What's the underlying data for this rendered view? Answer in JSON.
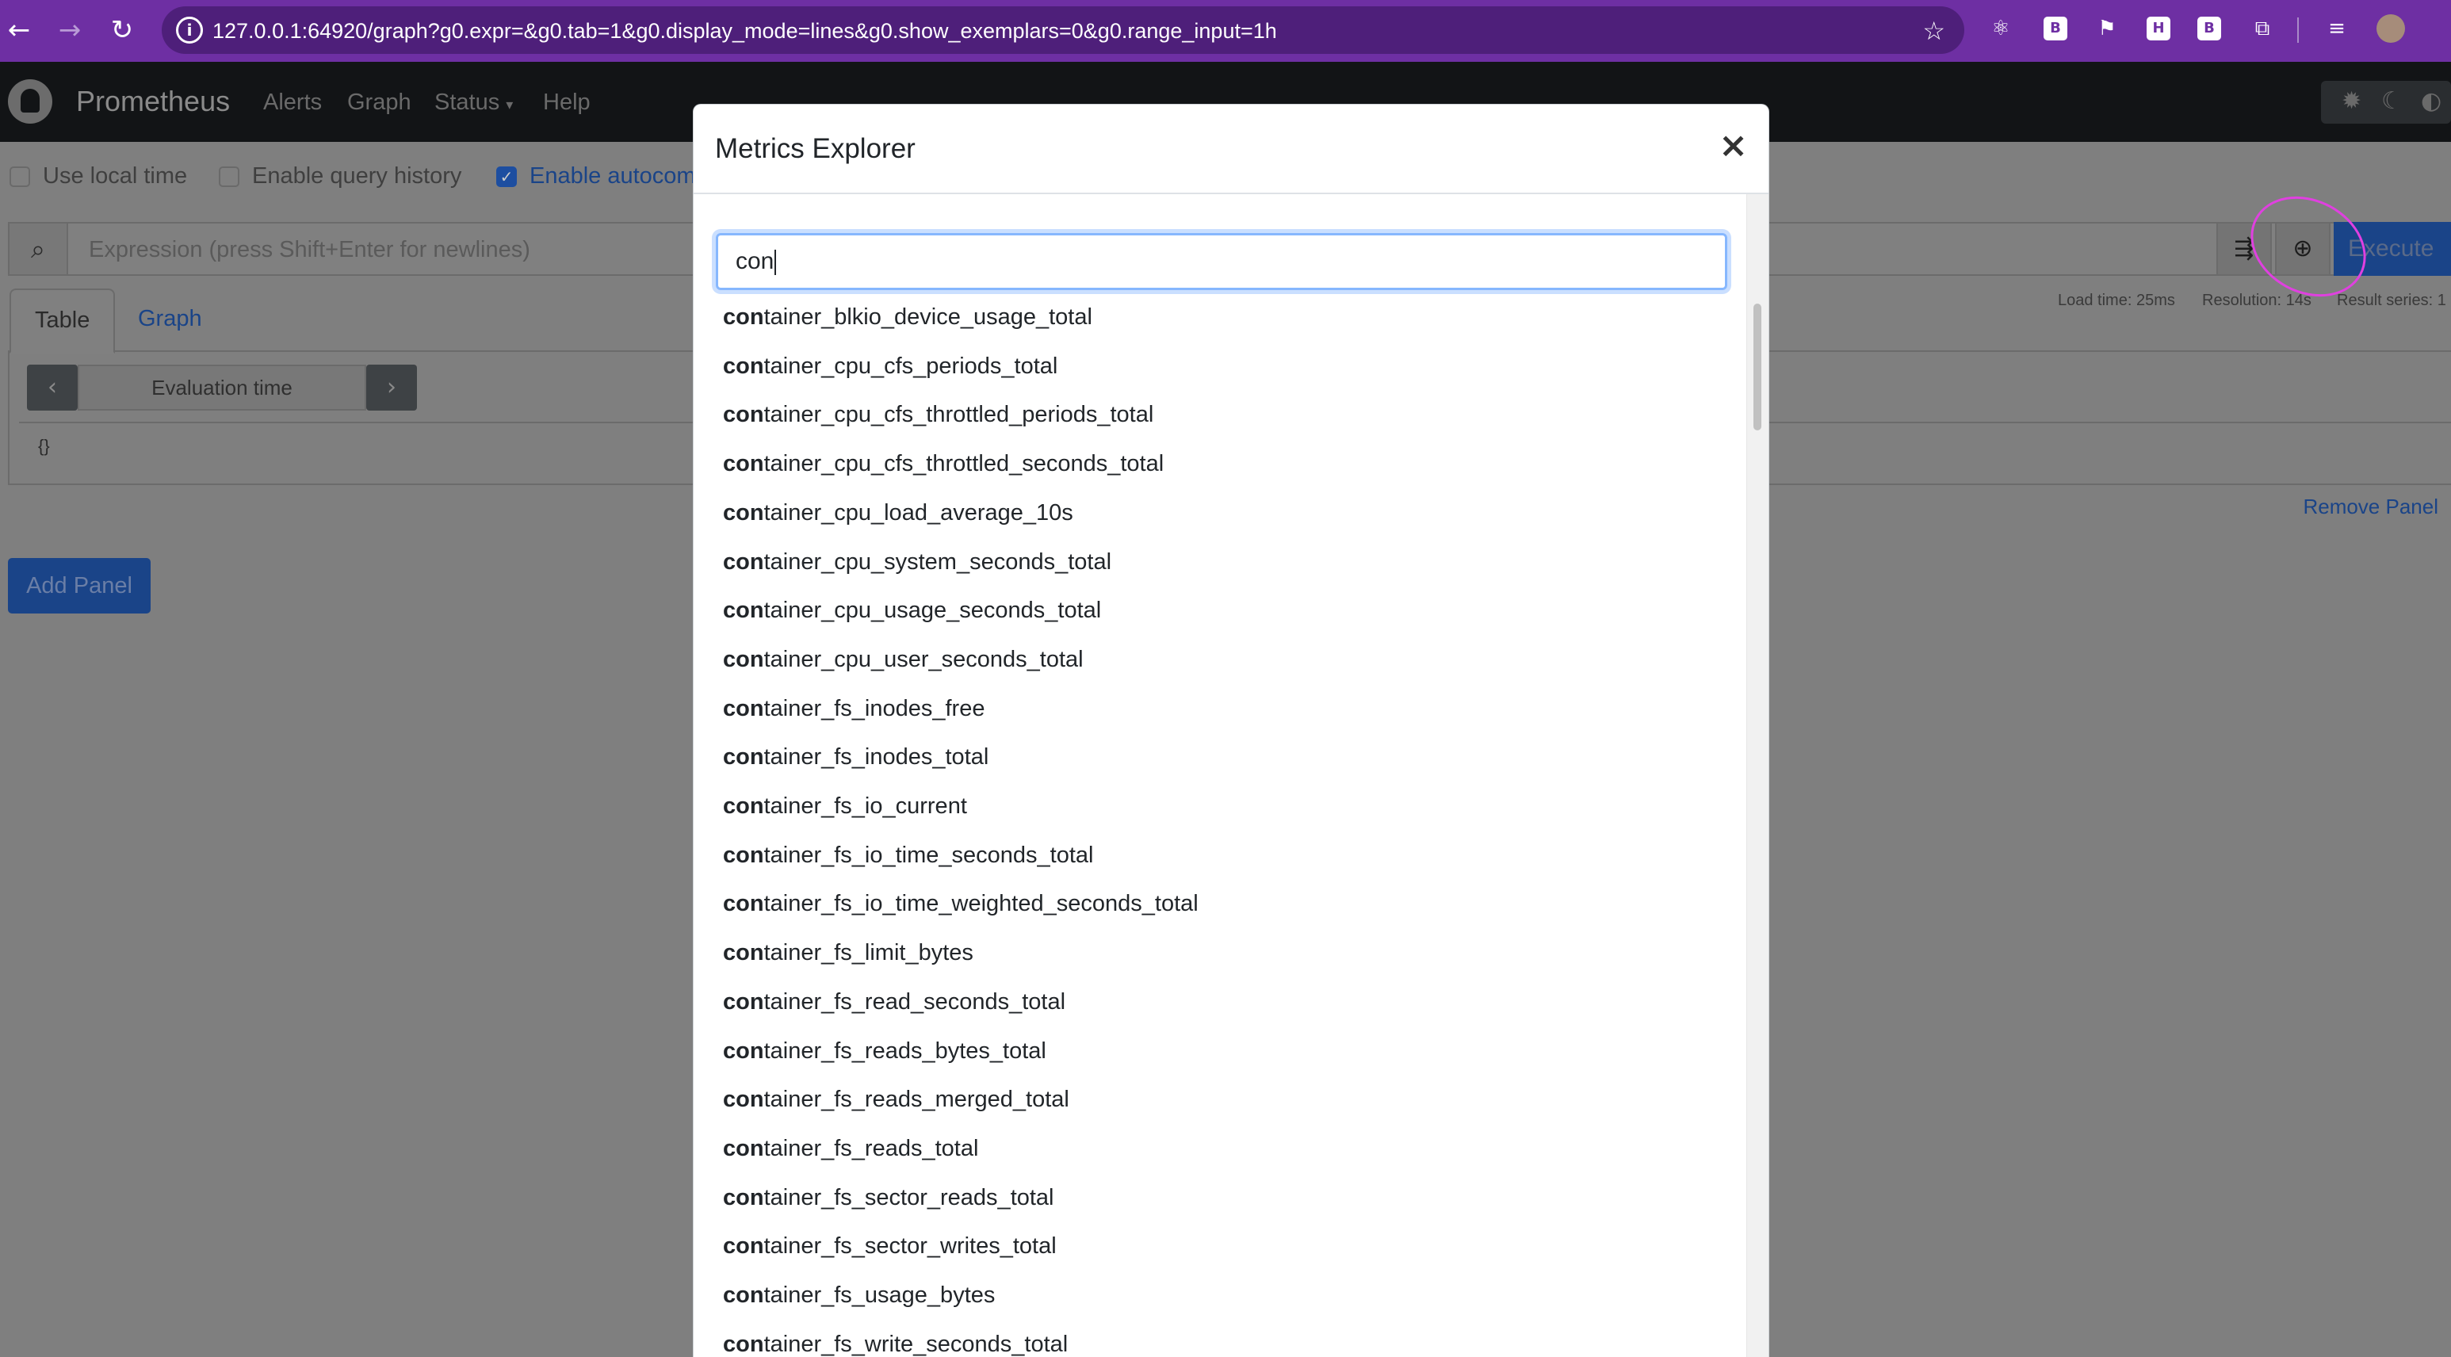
{
  "browser": {
    "url": "127.0.0.1:64920/graph?g0.expr=&g0.tab=1&g0.display_mode=lines&g0.show_exemplars=0&g0.range_input=1h",
    "accent": "#6e2fa3"
  },
  "nav": {
    "brand": "Prometheus",
    "links": [
      "Alerts",
      "Graph",
      "Status",
      "Help"
    ]
  },
  "options": {
    "local_time": "Use local time",
    "query_history": "Enable query history",
    "autocomplete": "Enable autocom"
  },
  "expression": {
    "placeholder": "Expression (press Shift+Enter for newlines)",
    "execute_label": "Execute"
  },
  "stats": {
    "load_time": "Load time: 25ms",
    "resolution": "Resolution: 14s",
    "result_series": "Result series: 1"
  },
  "panel": {
    "tabs": [
      "Table",
      "Graph"
    ],
    "eval_time": "Evaluation time",
    "result": "{}",
    "remove_label": "Remove Panel",
    "add_label": "Add Panel"
  },
  "modal": {
    "title": "Metrics Explorer",
    "close": "×",
    "search_value": "con",
    "match_prefix": "con",
    "metrics": [
      "tainer_blkio_device_usage_total",
      "tainer_cpu_cfs_periods_total",
      "tainer_cpu_cfs_throttled_periods_total",
      "tainer_cpu_cfs_throttled_seconds_total",
      "tainer_cpu_load_average_10s",
      "tainer_cpu_system_seconds_total",
      "tainer_cpu_usage_seconds_total",
      "tainer_cpu_user_seconds_total",
      "tainer_fs_inodes_free",
      "tainer_fs_inodes_total",
      "tainer_fs_io_current",
      "tainer_fs_io_time_seconds_total",
      "tainer_fs_io_time_weighted_seconds_total",
      "tainer_fs_limit_bytes",
      "tainer_fs_read_seconds_total",
      "tainer_fs_reads_bytes_total",
      "tainer_fs_reads_merged_total",
      "tainer_fs_reads_total",
      "tainer_fs_sector_reads_total",
      "tainer_fs_sector_writes_total",
      "tainer_fs_usage_bytes",
      "tainer_fs_write_seconds_total"
    ]
  }
}
